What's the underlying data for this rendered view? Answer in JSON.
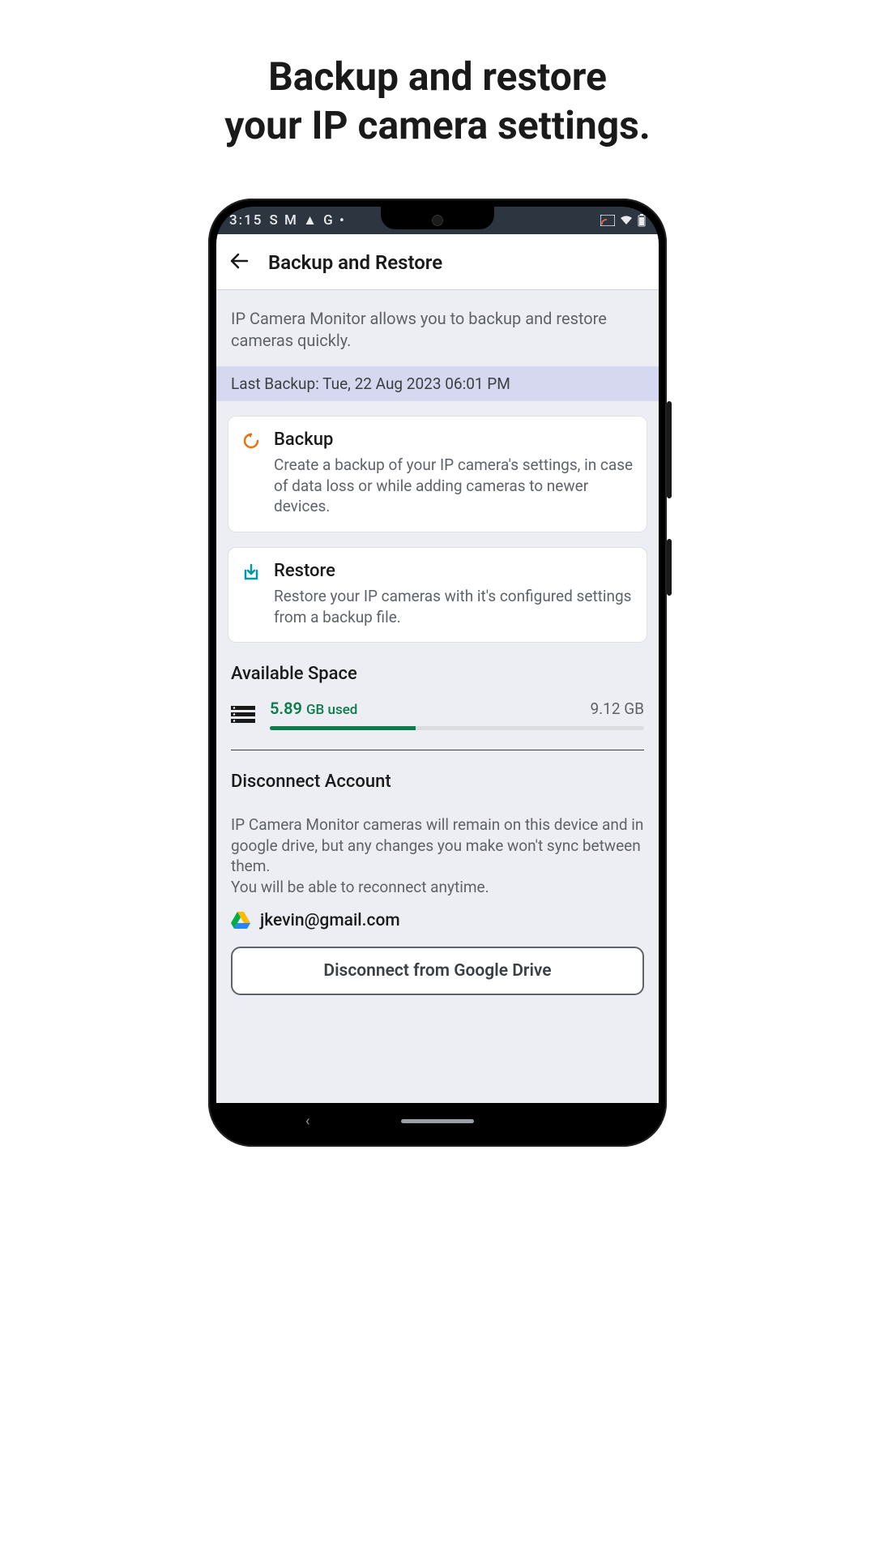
{
  "promo": {
    "line1": "Backup and restore",
    "line2": "your IP camera settings."
  },
  "statusBar": {
    "time": "3:15",
    "leftIcons": "S  M  ▲  G  •",
    "rightIcons": ""
  },
  "header": {
    "title": "Backup and Restore"
  },
  "intro": "IP Camera Monitor allows you to backup and restore cameras quickly.",
  "lastBackup": "Last Backup: Tue, 22 Aug 2023  06:01 PM",
  "cards": {
    "backup": {
      "title": "Backup",
      "desc": "Create a backup of your IP camera's settings, in case of data loss or while adding cameras to newer devices."
    },
    "restore": {
      "title": "Restore",
      "desc": "Restore your IP cameras with it's configured settings from a backup file."
    }
  },
  "space": {
    "title": "Available Space",
    "usedValue": "5.89",
    "usedUnit": "GB used",
    "total": "9.12 GB",
    "percentUsed": 39
  },
  "disconnect": {
    "title": "Disconnect Account",
    "desc1": "IP Camera Monitor cameras will remain on this device and in google drive, but any changes you make won't sync between them.",
    "desc2": "You will be able to reconnect anytime.",
    "email": "jkevin@gmail.com",
    "button": "Disconnect from Google Drive"
  }
}
